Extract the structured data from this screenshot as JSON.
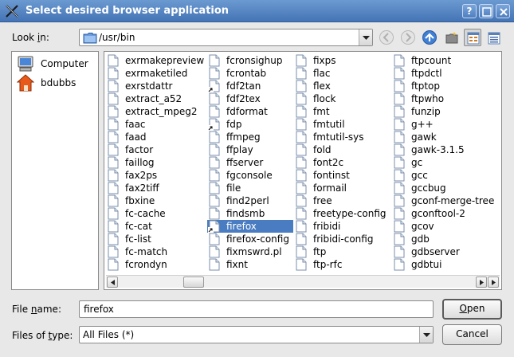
{
  "window": {
    "title": "Select desired browser application",
    "help_label": "?"
  },
  "toolbar": {
    "look_in_prefix": "Look ",
    "look_in_accel": "i",
    "look_in_suffix": "n:",
    "path": "/usr/bin"
  },
  "sidebar": {
    "items": [
      {
        "label": "Computer",
        "icon": "computer-icon"
      },
      {
        "label": "bdubbs",
        "icon": "home-folder-icon"
      }
    ]
  },
  "files": {
    "columns": [
      [
        "exrmakepreview",
        "exrmaketiled",
        "exrstdattr",
        "extract_a52",
        "extract_mpeg2",
        "faac",
        "faad",
        "factor",
        "faillog",
        "fax2ps",
        "fax2tiff",
        "fbxine",
        "fc-cache",
        "fc-cat",
        "fc-list",
        "fc-match",
        "fcrondyn"
      ],
      [
        "fcronsighup",
        "fcrontab",
        "fdf2tan",
        "fdf2tex",
        "fdformat",
        "fdp",
        "ffmpeg",
        "ffplay",
        "ffserver",
        "fgconsole",
        "file",
        "find2perl",
        "findsmb",
        "firefox",
        "firefox-config",
        "fixmswrd.pl",
        "fixnt"
      ],
      [
        "fixps",
        "flac",
        "flex",
        "flock",
        "fmt",
        "fmtutil",
        "fmtutil-sys",
        "fold",
        "font2c",
        "fontinst",
        "formail",
        "free",
        "freetype-config",
        "fribidi",
        "fribidi-config",
        "ftp",
        "ftp-rfc"
      ],
      [
        "ftpcount",
        "ftpdctl",
        "ftptop",
        "ftpwho",
        "funzip",
        "g++",
        "gawk",
        "gawk-3.1.5",
        "gc",
        "gcc",
        "gccbug",
        "gconf-merge-tree",
        "gconftool-2",
        "gcov",
        "gdb",
        "gdbserver",
        "gdbtui"
      ]
    ],
    "selected": "firefox",
    "symlinks": [
      "fdf2tan",
      "fdp",
      "firefox"
    ]
  },
  "form": {
    "filename_prefix": "File ",
    "filename_accel": "n",
    "filename_suffix": "ame:",
    "filename_value": "firefox",
    "filetype_prefix": "Files of ",
    "filetype_accel": "t",
    "filetype_suffix": "ype:",
    "filetype_value": "All Files (*)",
    "open_accel": "O",
    "open_rest": "pen",
    "cancel_label": "Cancel"
  }
}
